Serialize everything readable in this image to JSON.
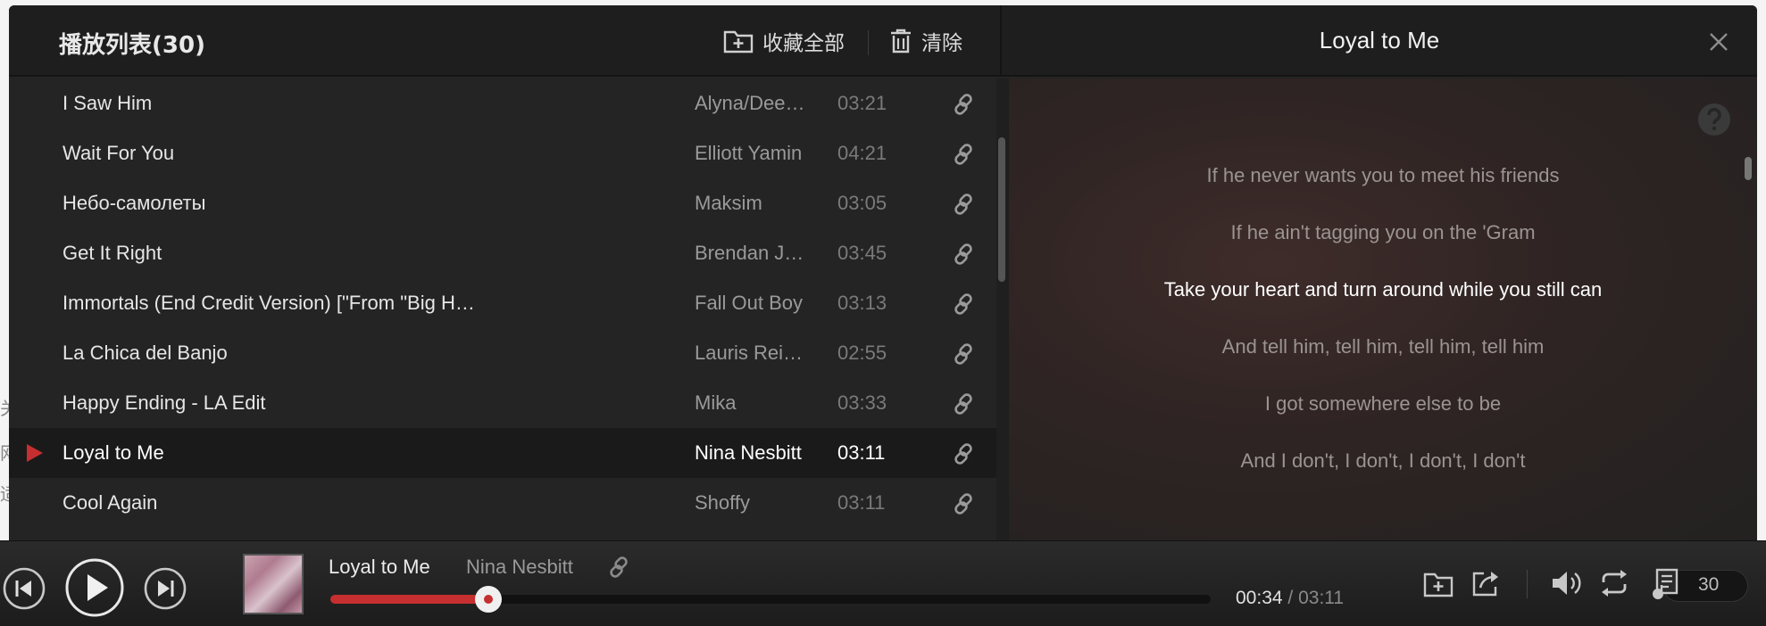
{
  "background_page": {
    "chars": [
      "关",
      "网",
      "适"
    ]
  },
  "panel": {
    "playlist_title": "播放列表(30)",
    "collect_all_label": "收藏全部",
    "clear_label": "清除",
    "now_playing_title": "Loyal to Me"
  },
  "songs": [
    {
      "name": "I Saw Him",
      "artist": "Alyna/Dee…",
      "duration": "03:21",
      "playing": false
    },
    {
      "name": "Wait For You",
      "artist": "Elliott Yamin",
      "duration": "04:21",
      "playing": false
    },
    {
      "name": "Небо-самолеты",
      "artist": "Maksim",
      "duration": "03:05",
      "playing": false
    },
    {
      "name": "Get It Right",
      "artist": "Brendan J…",
      "duration": "03:45",
      "playing": false
    },
    {
      "name": "Immortals (End Credit Version) [\"From \"Big H…",
      "artist": "Fall Out Boy",
      "duration": "03:13",
      "playing": false
    },
    {
      "name": "La Chica del Banjo",
      "artist": "Lauris Rei…",
      "duration": "02:55",
      "playing": false
    },
    {
      "name": "Happy Ending - LA Edit",
      "artist": "Mika",
      "duration": "03:33",
      "playing": false
    },
    {
      "name": "Loyal to Me",
      "artist": "Nina Nesbitt",
      "duration": "03:11",
      "playing": true
    },
    {
      "name": "Cool Again",
      "artist": "Shoffy",
      "duration": "03:11",
      "playing": false
    }
  ],
  "lyrics": [
    {
      "text": "If he never wants you to meet his friends",
      "current": false
    },
    {
      "text": "If he ain't tagging you on the 'Gram",
      "current": false
    },
    {
      "text": "Take your heart and turn around while you still can",
      "current": true
    },
    {
      "text": "And tell him, tell him, tell him, tell him",
      "current": false
    },
    {
      "text": "I got somewhere else to be",
      "current": false
    },
    {
      "text": "And I don't, I don't, I don't, I don't",
      "current": false
    }
  ],
  "player": {
    "title": "Loyal to Me",
    "artist": "Nina Nesbitt",
    "current_time": "00:34",
    "time_separator": "/",
    "total_time": "03:11",
    "progress_fraction": 0.18,
    "playlist_count": "30"
  },
  "colors": {
    "accent_red": "#c62f2f",
    "panel_bg": "#242424",
    "header_bg": "#1e1e1e"
  },
  "icons": {
    "collect": "folder-plus-icon",
    "clear": "trash-icon",
    "close": "close-icon",
    "help": "question-icon",
    "row_link": "link-icon",
    "playing": "play-triangle-icon"
  }
}
